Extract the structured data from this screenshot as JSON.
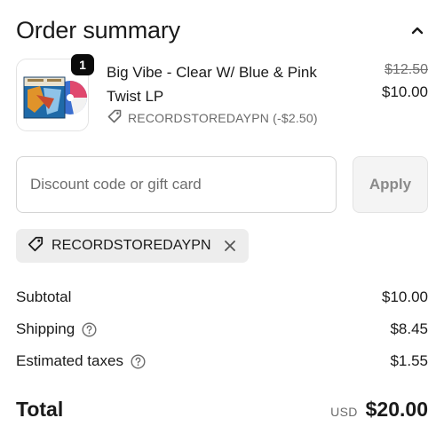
{
  "header": {
    "title": "Order summary",
    "collapse_icon": "chevron-up-icon"
  },
  "item": {
    "quantity": "1",
    "name": "Big Vibe - Clear W/ Blue & Pink Twist LP",
    "discount_label": "RECORDSTOREDAYPN (-$2.50)",
    "original_price": "$12.50",
    "price": "$10.00",
    "thumbnail_colors": {
      "cover": "#1f6aa8",
      "cover_accent": "#e0932a",
      "vinyl_blue": "#3b6fd0",
      "vinyl_pink": "#e0486e"
    }
  },
  "discount": {
    "placeholder": "Discount code or gift card",
    "value": "",
    "apply_label": "Apply"
  },
  "applied_code": {
    "code": "RECORDSTOREDAYPN",
    "remove_icon": "close-icon"
  },
  "summary": {
    "subtotal_label": "Subtotal",
    "subtotal_value": "$10.00",
    "shipping_label": "Shipping",
    "shipping_value": "$8.45",
    "taxes_label": "Estimated taxes",
    "taxes_value": "$1.55"
  },
  "total": {
    "label": "Total",
    "currency": "USD",
    "value": "$20.00"
  }
}
